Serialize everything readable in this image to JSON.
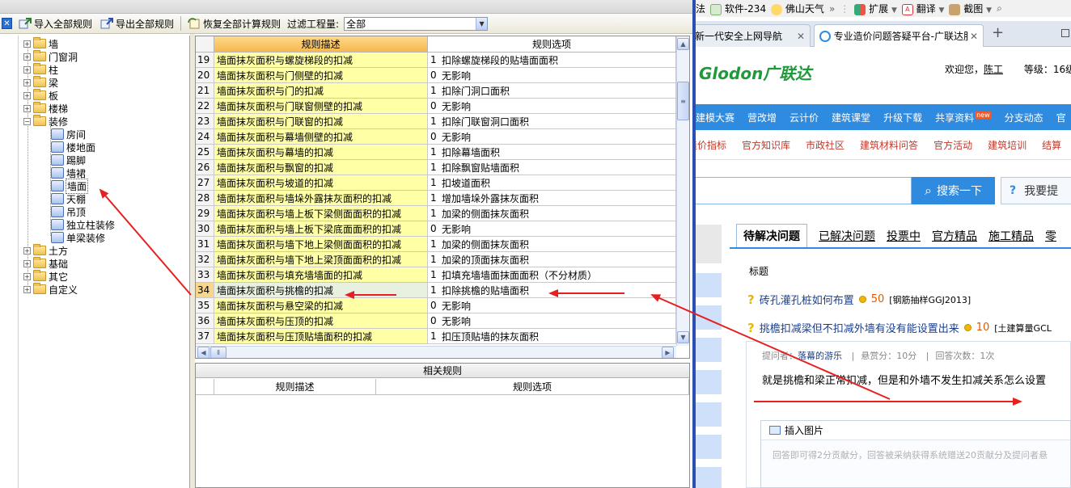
{
  "toolbar": {
    "import_all": "导入全部规则",
    "export_all": "导出全部规则",
    "restore_all": "恢复全部计算规则",
    "filter_label": "过滤工程量:",
    "filter_value": "全部"
  },
  "tree": {
    "top_items": [
      "墙",
      "门窗洞",
      "柱",
      "梁",
      "板",
      "楼梯",
      "装修"
    ],
    "decor_children": [
      "房间",
      "楼地面",
      "踢脚",
      "墙裙",
      "墙面",
      "天棚",
      "吊顶",
      "独立柱装修",
      "单梁装修"
    ],
    "bottom_items": [
      "土方",
      "基础",
      "其它",
      "自定义"
    ]
  },
  "grid": {
    "header_desc": "规则描述",
    "header_opt": "规则选项",
    "rows": [
      {
        "n": "19",
        "desc": "墙面抹灰面积与螺旋梯段的扣减",
        "v": "1",
        "opt": "扣除螺旋梯段的贴墙面面积"
      },
      {
        "n": "20",
        "desc": "墙面抹灰面积与门侧壁的扣减",
        "v": "0",
        "opt": "无影响"
      },
      {
        "n": "21",
        "desc": "墙面抹灰面积与门的扣减",
        "v": "1",
        "opt": "扣除门洞口面积"
      },
      {
        "n": "22",
        "desc": "墙面抹灰面积与门联窗侧壁的扣减",
        "v": "0",
        "opt": "无影响"
      },
      {
        "n": "23",
        "desc": "墙面抹灰面积与门联窗的扣减",
        "v": "1",
        "opt": "扣除门联窗洞口面积"
      },
      {
        "n": "24",
        "desc": "墙面抹灰面积与幕墙侧壁的扣减",
        "v": "0",
        "opt": "无影响"
      },
      {
        "n": "25",
        "desc": "墙面抹灰面积与幕墙的扣减",
        "v": "1",
        "opt": "扣除幕墙面积"
      },
      {
        "n": "26",
        "desc": "墙面抹灰面积与飘窗的扣减",
        "v": "1",
        "opt": "扣除飘窗贴墙面积"
      },
      {
        "n": "27",
        "desc": "墙面抹灰面积与坡道的扣减",
        "v": "1",
        "opt": "扣坡道面积"
      },
      {
        "n": "28",
        "desc": "墙面抹灰面积与墙垛外露抹灰面积的扣减",
        "v": "1",
        "opt": "增加墙垛外露抹灰面积"
      },
      {
        "n": "29",
        "desc": "墙面抹灰面积与墙上板下梁侧面面积的扣减",
        "v": "1",
        "opt": "加梁的侧面抹灰面积"
      },
      {
        "n": "30",
        "desc": "墙面抹灰面积与墙上板下梁底面面积的扣减",
        "v": "0",
        "opt": "无影响"
      },
      {
        "n": "31",
        "desc": "墙面抹灰面积与墙下地上梁侧面面积的扣减",
        "v": "1",
        "opt": "加梁的侧面抹灰面积"
      },
      {
        "n": "32",
        "desc": "墙面抹灰面积与墙下地上梁顶面面积的扣减",
        "v": "1",
        "opt": "加梁的顶面抹灰面积"
      },
      {
        "n": "33",
        "desc": "墙面抹灰面积与填充墙墙面的扣减",
        "v": "1",
        "opt": "扣填充墙墙面抹面面积（不分材质）"
      },
      {
        "n": "34",
        "desc": "墙面抹灰面积与挑檐的扣减",
        "v": "1",
        "opt": "扣除挑檐的贴墙面积"
      },
      {
        "n": "35",
        "desc": "墙面抹灰面积与悬空梁的扣减",
        "v": "0",
        "opt": "无影响"
      },
      {
        "n": "36",
        "desc": "墙面抹灰面积与压顶的扣减",
        "v": "0",
        "opt": "无影响"
      },
      {
        "n": "37",
        "desc": "墙面抹灰面积与压顶贴墙面积的扣减",
        "v": "1",
        "opt": "扣压顶贴墙的抹灰面积"
      }
    ]
  },
  "related": {
    "title": "相关规则",
    "header_desc": "规则描述",
    "header_opt": "规则选项"
  },
  "browser": {
    "bookmarks": [
      "法",
      "软件-234",
      "佛山天气",
      "»",
      "扩展",
      "翻译",
      "截图"
    ],
    "tabs": [
      {
        "label": "新一代安全上网导航"
      },
      {
        "label": "专业造价问题答疑平台-广联达服"
      }
    ],
    "logo": "Glodon广联达",
    "welcome": "欢迎您，",
    "user": "陈工",
    "level": "等级：",
    "level_value": "16级",
    "nav1": [
      "建模大赛",
      "营改增",
      "云计价",
      "建筑课堂",
      "升级下载",
      "共享资料",
      "分支动态",
      "官"
    ],
    "new_badge": "new",
    "nav2": [
      "造价指标",
      "官方知识库",
      "市政社区",
      "建筑材料问答",
      "官方活动",
      "建筑培训",
      "结算"
    ],
    "search_button": "搜索一下",
    "ask_button": "我要提",
    "qtabs": [
      "待解决问题",
      "已解决问题",
      "投票中",
      "官方精品",
      "施工精品",
      "零"
    ],
    "col_title": "标题",
    "questions": [
      {
        "title": "砖孔灌孔桩如何布置",
        "points": "50",
        "tag": "[钢筋抽样GGJ2013]"
      },
      {
        "title": "挑檐扣减梁但不扣减外墙有没有能设置出来",
        "points": "10",
        "tag": "[土建算量GCL"
      }
    ],
    "meta_asker_label": "提问者：",
    "meta_asker": "落幕的游乐",
    "meta_reward": "悬赏分：10分",
    "meta_answers": "回答次数：1次",
    "question_body": "就是挑檐和梁正常扣减，但是和外墙不发生扣减关系怎么设置",
    "insert_image": "插入图片",
    "answer_placeholder": "回答即可得2分贡献分，回答被采纳获得系统赠送20贡献分及提问者悬"
  },
  "colors": {
    "highlight_row": "#e8f0e0",
    "desc_bg": "#ffffa6",
    "arrow": "#e62020",
    "site_blue": "#2f8be0",
    "logo_green": "#1f9a3a"
  }
}
